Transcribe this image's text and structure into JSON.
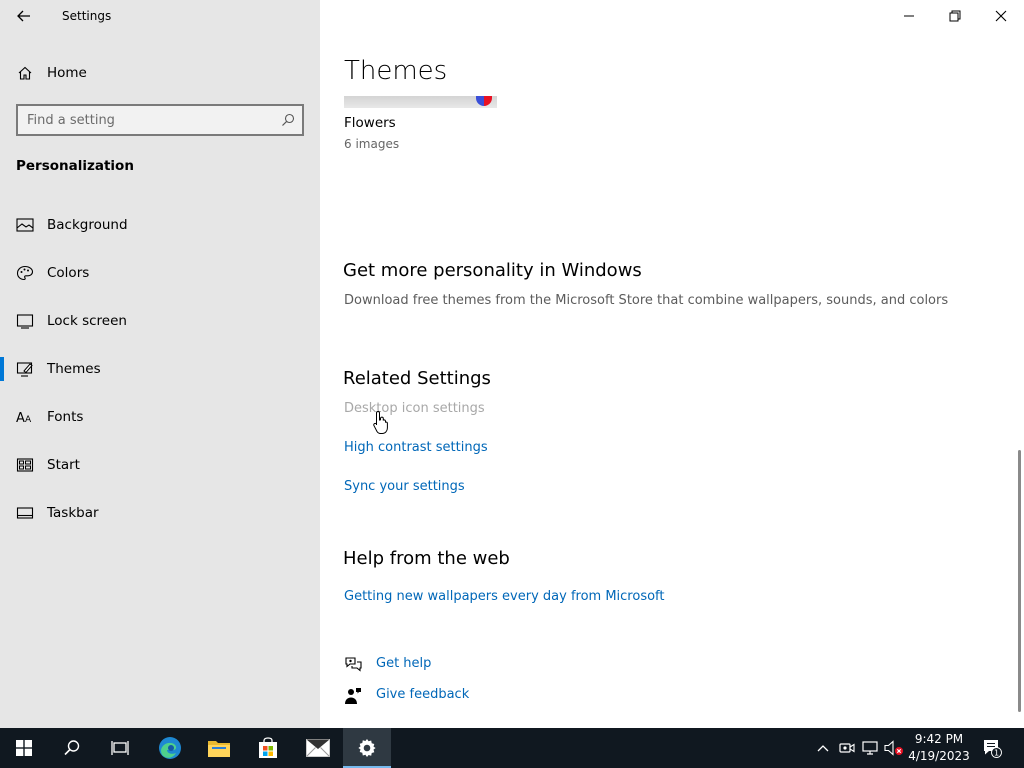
{
  "window": {
    "app_title": "Settings",
    "controls": [
      "minimize-icon",
      "restore-icon",
      "close-icon"
    ]
  },
  "sidebar": {
    "home_label": "Home",
    "search_placeholder": "Find a setting",
    "section_title": "Personalization",
    "items": [
      {
        "label": "Background",
        "icon": "picture-icon",
        "active": false
      },
      {
        "label": "Colors",
        "icon": "palette-icon",
        "active": false
      },
      {
        "label": "Lock screen",
        "icon": "lock-screen-icon",
        "active": false
      },
      {
        "label": "Themes",
        "icon": "brush-icon",
        "active": true
      },
      {
        "label": "Fonts",
        "icon": "font-icon",
        "active": false
      },
      {
        "label": "Start",
        "icon": "start-grid-icon",
        "active": false
      },
      {
        "label": "Taskbar",
        "icon": "taskbar-icon",
        "active": false
      }
    ]
  },
  "main": {
    "title": "Themes",
    "theme": {
      "name": "Flowers",
      "count": "6 images"
    },
    "personality": {
      "heading": "Get more personality in Windows",
      "description": "Download free themes from the Microsoft Store that combine wallpapers, sounds, and colors"
    },
    "related": {
      "heading": "Related Settings",
      "links": [
        "Desktop icon settings",
        "High contrast settings",
        "Sync your settings"
      ]
    },
    "help": {
      "heading": "Help from the web",
      "link": "Getting new wallpapers every day from Microsoft",
      "get_help": "Get help",
      "give_feedback": "Give feedback"
    }
  },
  "taskbar": {
    "pinned": [
      "windows-start-icon",
      "search-icon",
      "task-view-icon",
      "edge-icon",
      "file-explorer-icon",
      "store-icon",
      "mail-icon",
      "settings-gear-icon"
    ],
    "time": "9:42 PM",
    "date": "4/19/2023",
    "notification_count": "1"
  },
  "colors": {
    "accent": "#0078d7",
    "link": "#0067b8",
    "sidebar_bg": "#e6e6e6",
    "taskbar_bg": "#101820"
  }
}
